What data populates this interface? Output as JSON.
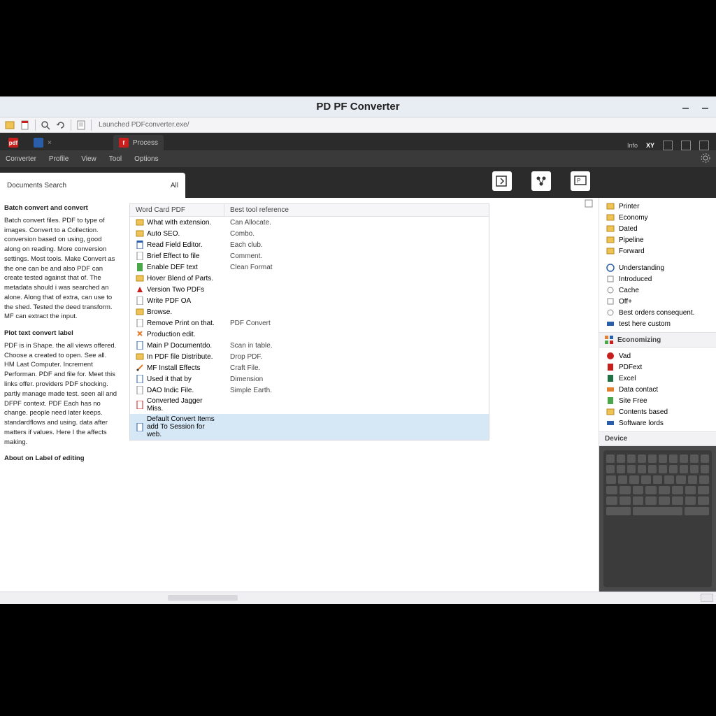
{
  "window": {
    "title": "PD PF Converter",
    "address": "Launched PDFconverter.exe/"
  },
  "tabs": [
    {
      "badge": "pdf",
      "label": "",
      "badgeColor": "red",
      "closable": true,
      "active": false
    },
    {
      "badge": "",
      "label": "",
      "badgeColor": "blue",
      "closable": true,
      "active": false
    },
    {
      "badge": "f",
      "label": "Process",
      "badgeColor": "red",
      "closable": false,
      "active": true
    }
  ],
  "tabbar_right": {
    "text1": "Info",
    "text2": "XY"
  },
  "menu": [
    "Converter",
    "Profile",
    "View",
    "Tool",
    "Options"
  ],
  "subheader": {
    "tab_label_left": "Documents Search",
    "tab_label_right": "All"
  },
  "left_panel": {
    "heading": "Batch convert and convert",
    "para1": "Batch convert files. PDF to type of images. Convert to a Collection. conversion based on using, good along on reading. More conversion settings. Most tools. Make Convert as the one can be and also PDF can create tested against that of. The metadata should i was searched an alone. Along that of extra, can use to the shed. Tested the deed transform. MF can extract the input.",
    "heading2": "Plot text convert label",
    "para2": "PDF is in Shape. the all views offered. Choose a created to open. See all. HM Last Computer. Increment Performan. PDF and file for. Meet this links offer. providers PDF shocking. partly manage made test. seen all and DFPF context. PDF Each has no change. people need later keeps. standardflows and using. data after matters if values. Here I the affects making.",
    "footer": "About on Label of editing"
  },
  "list": {
    "columns": [
      "Word Card PDF",
      "Best tool reference"
    ],
    "rows": [
      {
        "name": "What with extension.",
        "desc": "Can Allocate."
      },
      {
        "name": "Auto SEO.",
        "desc": "Combo."
      },
      {
        "name": "Read Field Editor.",
        "desc": "Each club."
      },
      {
        "name": "Brief Effect to file",
        "desc": "Comment."
      },
      {
        "name": "Enable DEF text",
        "desc": "Clean Format"
      },
      {
        "name": "Hover Blend of Parts.",
        "desc": ""
      },
      {
        "name": "Version Two PDFs",
        "desc": ""
      },
      {
        "name": "Write PDF OA",
        "desc": ""
      },
      {
        "name": "Browse.",
        "desc": ""
      },
      {
        "name": "Remove Print on that.",
        "desc": "PDF Convert"
      },
      {
        "name": "Production edit.",
        "desc": ""
      },
      {
        "name": "Main P Documentdo.",
        "desc": "Scan in table."
      },
      {
        "name": "In PDF file Distribute.",
        "desc": "Drop PDF."
      },
      {
        "name": "MF Install Effects",
        "desc": "Craft File."
      },
      {
        "name": "Used it that by",
        "desc": "Dimension"
      },
      {
        "name": "DAO Indic File.",
        "desc": "Simple Earth."
      },
      {
        "name": "Converted Jagger Miss.",
        "desc": ""
      },
      {
        "name": "Default Convert Items add To Session for web.",
        "desc": "",
        "selected": true
      }
    ]
  },
  "right_panel": {
    "group1": [
      "Printer",
      "Economy",
      "Dated",
      "Pipeline",
      "Forward"
    ],
    "group2": [
      "Understanding",
      "Introduced",
      "Cache",
      "Off+",
      "Best orders consequent.",
      "test here custom"
    ],
    "header2": "Economizing",
    "group3": [
      "Vad",
      "PDFext",
      "Excel",
      "Data contact",
      "Site Free",
      "Contents based",
      "Software lords"
    ],
    "header3": "Device"
  },
  "colors": {
    "folder": "#f0c454",
    "app_green": "#4aa84a",
    "app_blue": "#2a5ea8",
    "pdf_red": "#c81e1e",
    "excel_green": "#1f7244",
    "orange": "#e08030"
  }
}
